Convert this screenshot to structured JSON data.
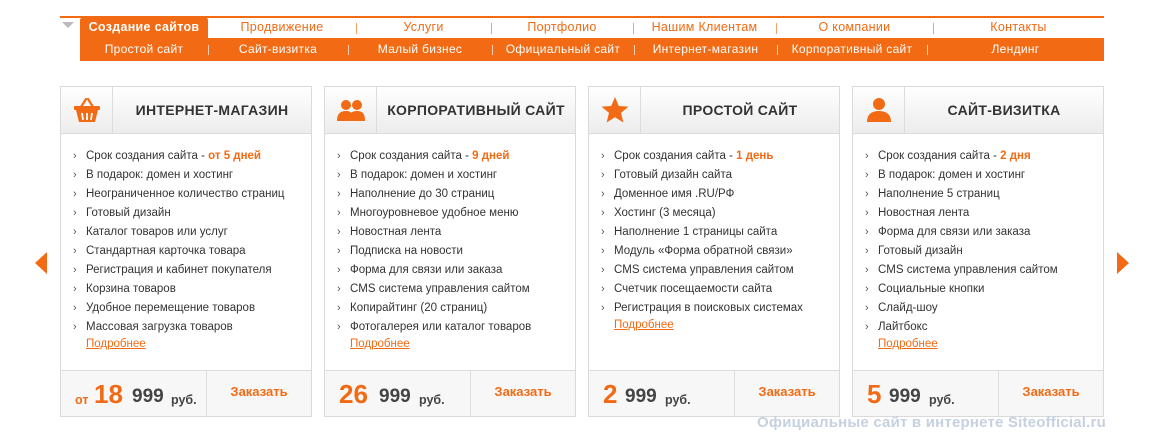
{
  "nav": {
    "main": [
      {
        "label": "Создание сайтов",
        "active": true
      },
      {
        "label": "Продвижение"
      },
      {
        "label": "Услуги"
      },
      {
        "label": "Портфолио"
      },
      {
        "label": "Нашим Клиентам"
      },
      {
        "label": "О компании"
      },
      {
        "label": "Контакты"
      }
    ],
    "sub": [
      {
        "label": "Простой сайт"
      },
      {
        "label": "Сайт-визитка"
      },
      {
        "label": "Малый бизнес"
      },
      {
        "label": "Официальный сайт"
      },
      {
        "label": "Интернет-магазин"
      },
      {
        "label": "Корпоративный сайт"
      },
      {
        "label": "Лендинг"
      }
    ]
  },
  "colors": {
    "accent": "#f26a14",
    "text": "#333333",
    "border": "#dadada"
  },
  "cards": [
    {
      "icon": "basket-icon",
      "title": "ИНТЕРНЕТ-МАГАЗИН",
      "term_label": "Срок создания сайта - ",
      "term_value": "от 5 дней",
      "features": [
        "В подарок: домен и хостинг",
        "Неограниченное количество страниц",
        "Готовый дизайн",
        "Каталог товаров или услуг",
        "Стандартная карточка товара",
        "Регистрация и кабинет покупателя",
        "Корзина товаров",
        "Удобное перемещение товаров",
        "Массовая загрузка товаров"
      ],
      "more": "Подробнее",
      "price_prefix": "от",
      "price_main": "18",
      "price_rest": "999",
      "currency": "руб.",
      "order": "Заказать"
    },
    {
      "icon": "group-users-icon",
      "title": "КОРПОРАТИВНЫЙ САЙТ",
      "term_label": "Срок создания сайта - ",
      "term_value": "9 дней",
      "features": [
        "В подарок: домен и хостинг",
        "Наполнение до 30 страниц",
        "Многоуровневое удобное меню",
        "Новостная лента",
        "Подписка на новости",
        "Форма для связи или заказа",
        "CMS система управления сайтом",
        "Копирайтинг (20 страниц)",
        "Фотогалерея или каталог товаров"
      ],
      "more": "Подробнее",
      "price_prefix": "",
      "price_main": "26",
      "price_rest": "999",
      "currency": "руб.",
      "order": "Заказать"
    },
    {
      "icon": "star-icon",
      "title": "ПРОСТОЙ САЙТ",
      "term_label": "Срок создания сайта - ",
      "term_value": "1 день",
      "features": [
        "Готовый дизайн сайта",
        "Доменное имя .RU/РФ",
        "Хостинг (3 месяца)",
        "Наполнение 1 страницы сайта",
        "Модуль «Форма обратной связи»",
        "CMS система управления сайтом",
        "Счетчик посещаемости сайта",
        "Регистрация в поисковых системах"
      ],
      "more": "Подробнее",
      "price_prefix": "",
      "price_main": "2",
      "price_rest": "999",
      "currency": "руб.",
      "order": "Заказать"
    },
    {
      "icon": "user-icon",
      "title": "САЙТ-ВИЗИТКА",
      "term_label": "Срок создания сайта - ",
      "term_value": "2 дня",
      "features": [
        "В подарок: домен и хостинг",
        "Наполнение 5 страниц",
        "Новостная лента",
        "Форма для связи или заказа",
        "Готовый дизайн",
        "CMS система управления сайтом",
        "Социальные кнопки",
        "Слайд-шоу",
        "Лайтбокс"
      ],
      "more": "Подробнее",
      "price_prefix": "",
      "price_main": "5",
      "price_rest": "999",
      "currency": "руб.",
      "order": "Заказать"
    }
  ],
  "arrows": {
    "prev": "arrow-left-icon",
    "next": "arrow-right-icon"
  },
  "watermark": "Официальные сайт в интернете Siteofficial.ru"
}
